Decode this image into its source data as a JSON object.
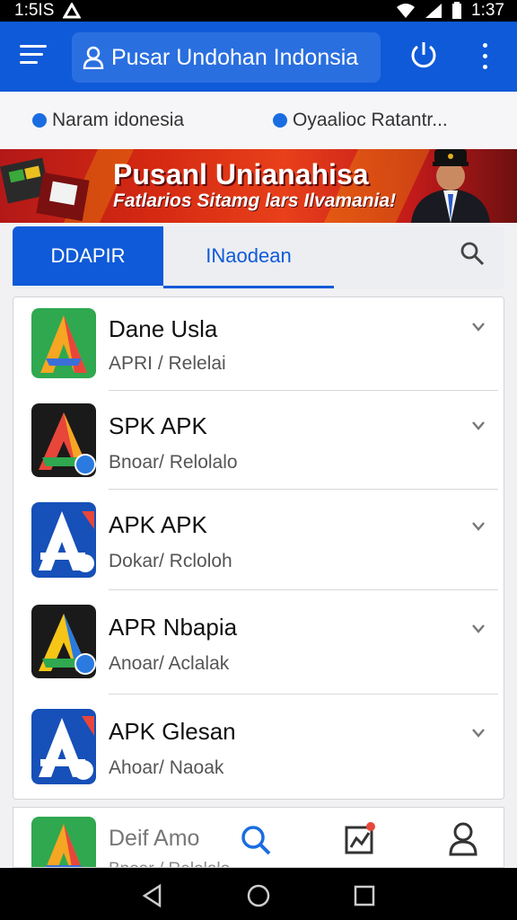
{
  "status_bar": {
    "time_left": "1:5IS",
    "time_right": "1:37"
  },
  "app_bar": {
    "title": "Pusar Undohan Indonsia"
  },
  "sub_bar": {
    "item_1": "Naram idonesia",
    "item_2": "Oyaalioc Ratantr..."
  },
  "banner": {
    "headline": "Pusanl Unianahisa",
    "subline": "Fatlarios Sitamg lars Ilvamania!"
  },
  "tabs": [
    {
      "label": "DDAPIR"
    },
    {
      "label": "INaodean"
    }
  ],
  "apps": [
    {
      "name": "Dane Usla",
      "sub": "APRI / Relelai"
    },
    {
      "name": "SPK APK",
      "sub": "Bnoar/ Relolalo"
    },
    {
      "name": "APK APK",
      "sub": "Dokar/ Rcloloh"
    },
    {
      "name": "APR Nbapia",
      "sub": "Anoar/ Aclalak"
    },
    {
      "name": "APK Glesan",
      "sub": "Ahoar/ Naoak"
    }
  ],
  "bottom_item": {
    "name": "Deif Amo",
    "sub": "Bnoar / Relolalo"
  },
  "colors": {
    "primary": "#0f5ad8",
    "banner_red": "#d52a12"
  },
  "icons": [
    "menu-icon",
    "person-icon",
    "power-icon",
    "more-vert-icon",
    "search-icon",
    "chevron-right-icon",
    "chart-icon",
    "profile-icon",
    "back-icon",
    "home-icon",
    "recents-icon"
  ]
}
